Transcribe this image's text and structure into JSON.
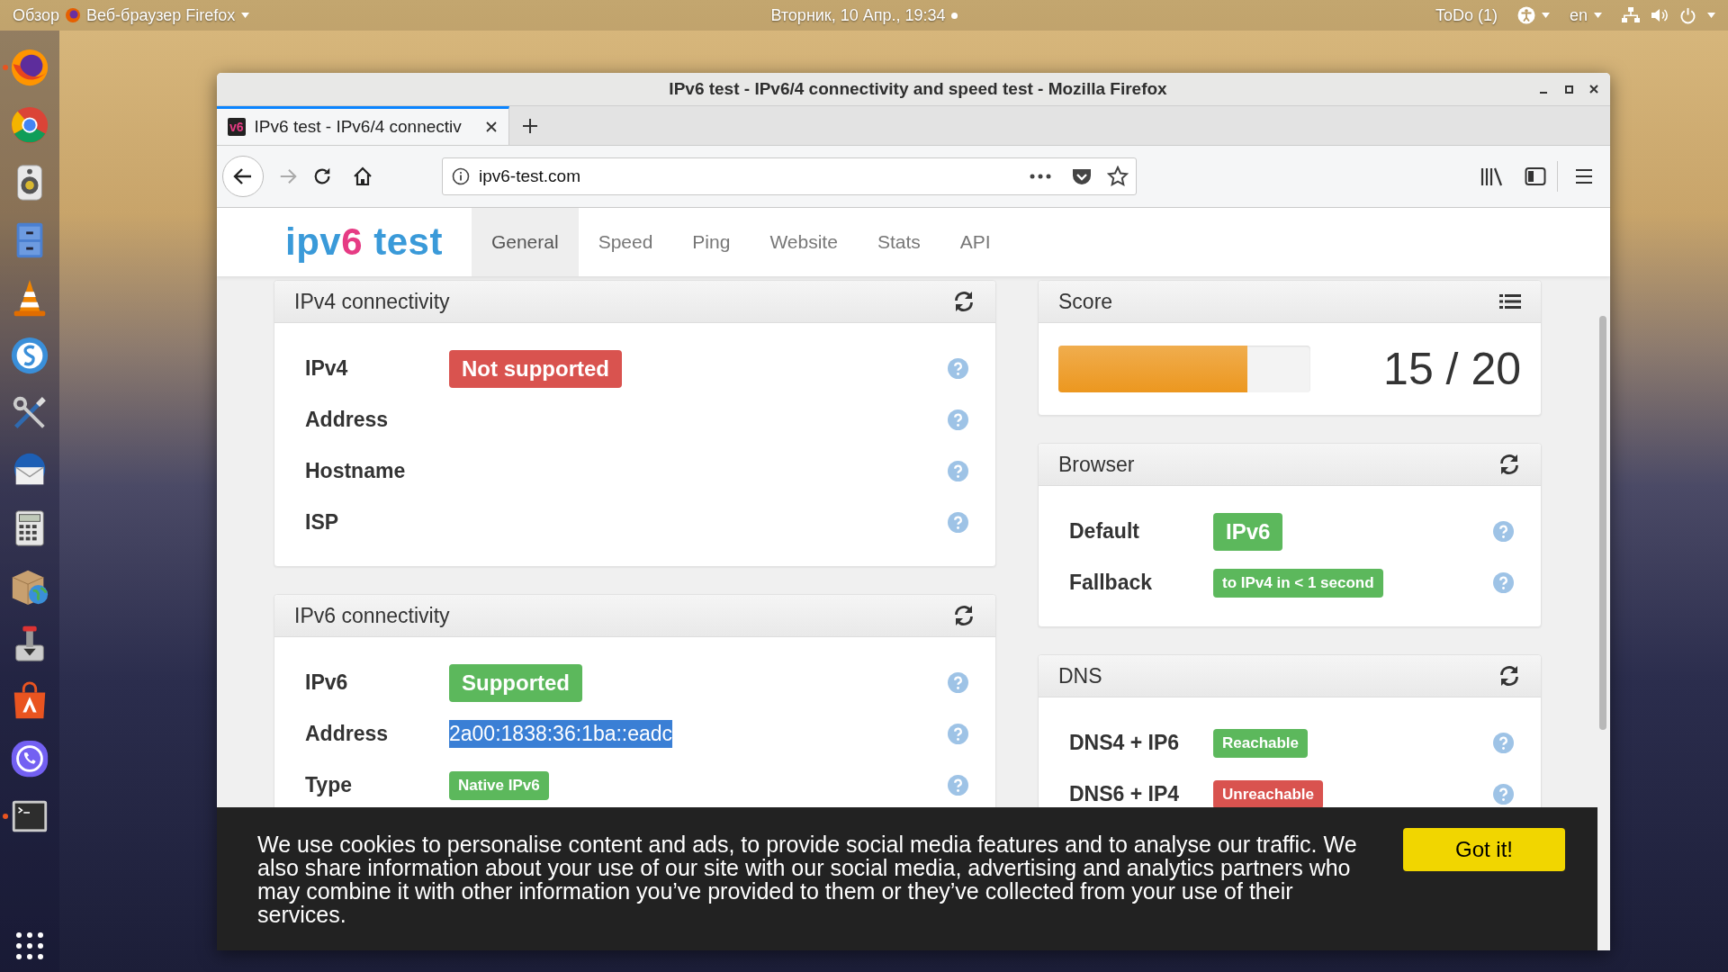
{
  "top_bar": {
    "activities": "Обзор",
    "app_menu": "Веб-браузер Firefox",
    "clock": "Вторник, 10 Апр., 19:34",
    "has_notification": true,
    "todo": "ToDo (1)",
    "language": "en"
  },
  "dock": [
    {
      "kind": "firefox",
      "running": true
    },
    {
      "kind": "chrome",
      "running": false
    },
    {
      "kind": "speaker",
      "running": false
    },
    {
      "kind": "files",
      "running": false
    },
    {
      "kind": "cone",
      "running": false
    },
    {
      "kind": "simplenote",
      "running": false
    },
    {
      "kind": "tools",
      "running": false
    },
    {
      "kind": "mail",
      "running": false
    },
    {
      "kind": "calculator",
      "running": false
    },
    {
      "kind": "package",
      "running": false
    },
    {
      "kind": "installer",
      "running": false
    },
    {
      "kind": "store",
      "running": false
    },
    {
      "kind": "phone",
      "running": false
    },
    {
      "kind": "terminal",
      "running": true
    }
  ],
  "window": {
    "title": "IPv6 test - IPv6/4 connectivity and speed test - Mozilla Firefox"
  },
  "tabs": [
    {
      "favicon": "v6",
      "label": "IPv6 test - IPv6/4 connectiv",
      "selected": true
    }
  ],
  "toolbar": {
    "forward_enabled": false,
    "url": "ipv6-test.com"
  },
  "site": {
    "logo": [
      {
        "text": "ipv",
        "color": "#3a9ad9"
      },
      {
        "text": "6",
        "color": "#e63b84"
      },
      {
        "text": " test",
        "color": "#3a9ad9"
      }
    ],
    "nav": [
      {
        "label": "General",
        "selected": true
      },
      {
        "label": "Speed",
        "selected": false
      },
      {
        "label": "Ping",
        "selected": false
      },
      {
        "label": "Website",
        "selected": false
      },
      {
        "label": "Stats",
        "selected": false
      },
      {
        "label": "API",
        "selected": false
      }
    ]
  },
  "left_column": [
    {
      "title": "IPv4 connectivity",
      "header_icon": {
        "kind": "reload"
      },
      "kind": "rows",
      "rows": [
        {
          "label": "IPv4",
          "value": {
            "kind": "badge",
            "text": "Not supported",
            "color": "#d9534f",
            "large": true
          }
        },
        {
          "label": "Address"
        },
        {
          "label": "Hostname"
        },
        {
          "label": "ISP"
        }
      ]
    },
    {
      "title": "IPv6 connectivity",
      "header_icon": {
        "kind": "reload"
      },
      "kind": "rows",
      "rows": [
        {
          "label": "IPv6",
          "value": {
            "kind": "badge",
            "text": "Supported",
            "color": "#5cb85c",
            "large": true
          }
        },
        {
          "label": "Address",
          "value": {
            "kind": "highlighted",
            "text": "2a00:1838:36:1ba::eadc"
          }
        },
        {
          "label": "Type",
          "value": {
            "kind": "badge",
            "text": "Native IPv6",
            "color": "#5cb85c",
            "large": false
          }
        }
      ]
    }
  ],
  "right_column": [
    {
      "title": "Score",
      "header_icon": {
        "kind": "list"
      },
      "kind": "score",
      "level": 0.75,
      "reading": "15 / 20"
    },
    {
      "title": "Browser",
      "header_icon": {
        "kind": "reload"
      },
      "kind": "rows",
      "rows": [
        {
          "label": "Default",
          "value": {
            "kind": "badge",
            "text": "IPv6",
            "color": "#5cb85c",
            "large": true
          }
        },
        {
          "label": "Fallback",
          "value": {
            "kind": "badge",
            "text": "to IPv4 in < 1 second",
            "color": "#5cb85c",
            "large": false
          }
        }
      ]
    },
    {
      "title": "DNS",
      "header_icon": {
        "kind": "reload"
      },
      "kind": "rows",
      "rows": [
        {
          "label": "DNS4 + IP6",
          "value": {
            "kind": "badge",
            "text": "Reachable",
            "color": "#5cb85c",
            "large": false
          }
        },
        {
          "label": "DNS6 + IP4",
          "value": {
            "kind": "badge",
            "text": "Unreachable",
            "color": "#d9534f",
            "large": false
          }
        }
      ]
    }
  ],
  "cookie_banner": {
    "text": "We use cookies to personalise content and ads, to provide social media features and to analyse our traffic. We also share information about your use of our site with our social media, advertising and analytics partners who may combine it with other information you’ve provided to them or they’ve collected from your use of their services.",
    "button": "Got it!"
  }
}
